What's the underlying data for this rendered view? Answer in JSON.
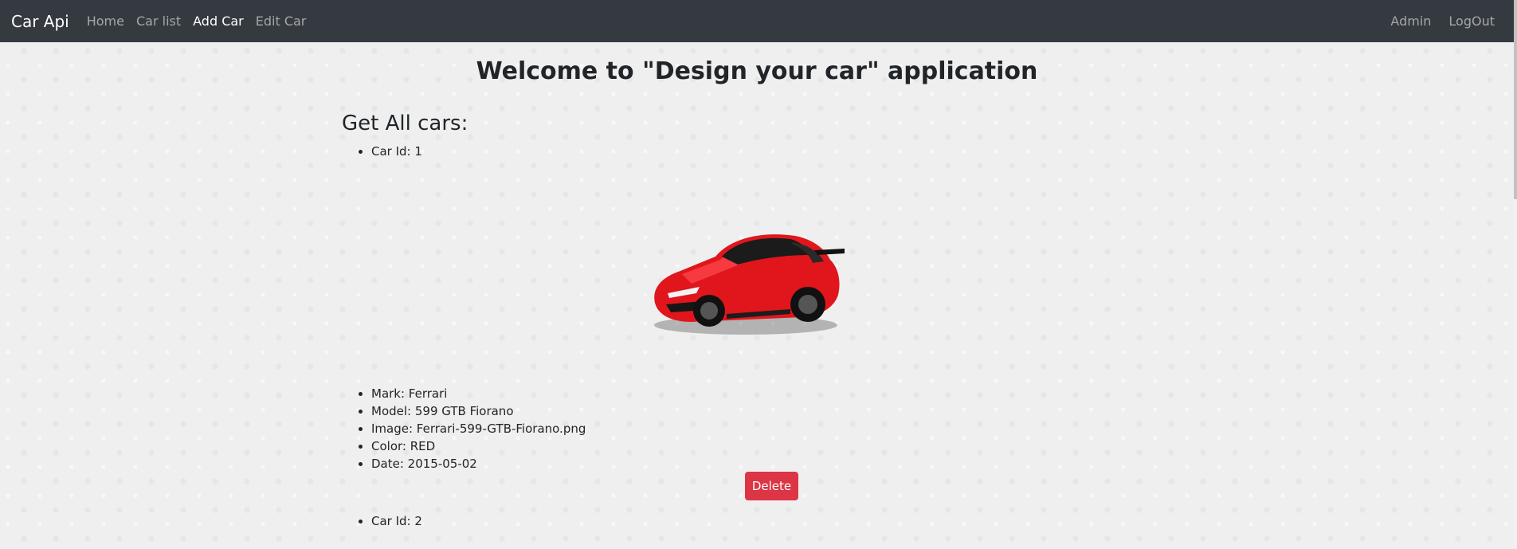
{
  "navbar": {
    "brand": "Car Api",
    "links": [
      "Home",
      "Car list",
      "Add Car",
      "Edit Car"
    ],
    "right_links": [
      "Admin",
      "LogOut"
    ]
  },
  "main": {
    "title": "Welcome to \"Design your car\" application",
    "section_title": "Get All cars:"
  },
  "cars": [
    {
      "id_label": "Car Id: 1",
      "mark": "Mark: Ferrari",
      "model": "Model: 599 GTB Fiorano",
      "image": "Image: Ferrari-599-GTB-Fiorano.png",
      "color": "Color: RED",
      "date": "Date: 2015-05-02",
      "delete_label": "Delete"
    },
    {
      "id_label": "Car Id: 2"
    }
  ],
  "colors": {
    "navbar_bg": "#343a40",
    "delete_btn": "#dc3545",
    "car_body": "#e0161c"
  }
}
